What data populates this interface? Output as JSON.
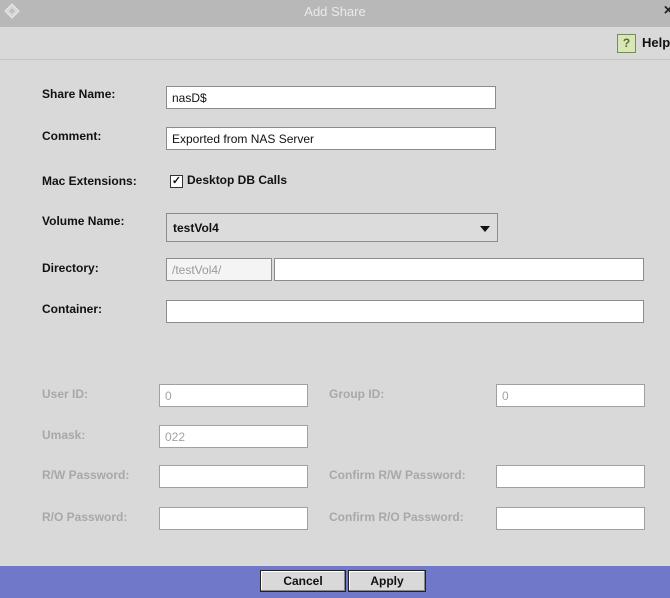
{
  "window": {
    "title": "Add Share",
    "close_label": "×",
    "help_label": "Help",
    "help_icon_glyph": "?"
  },
  "form": {
    "share_name": {
      "label": "Share Name:",
      "value": "nasD$"
    },
    "comment": {
      "label": "Comment:",
      "value": "Exported from NAS Server"
    },
    "mac_extensions": {
      "label": "Mac Extensions:",
      "checkbox_label": "Desktop DB Calls",
      "checked": true,
      "check_glyph": "✓"
    },
    "volume_name": {
      "label": "Volume Name:",
      "value": "testVol4"
    },
    "directory": {
      "label": "Directory:",
      "prefix": "/testVol4/",
      "value": ""
    },
    "container": {
      "label": "Container:",
      "value": ""
    },
    "user_id": {
      "label": "User ID:",
      "value": "0"
    },
    "group_id": {
      "label": "Group ID:",
      "value": "0"
    },
    "umask": {
      "label": "Umask:",
      "value": "022"
    },
    "rw_password": {
      "label": "R/W Password:",
      "value": ""
    },
    "confirm_rw_password": {
      "label": "Confirm R/W Password:",
      "value": ""
    },
    "ro_password": {
      "label": "R/O Password:",
      "value": ""
    },
    "confirm_ro_password": {
      "label": "Confirm R/O Password:",
      "value": ""
    }
  },
  "buttons": {
    "cancel": "Cancel",
    "apply": "Apply"
  },
  "colors": {
    "background": "#d9d9d9",
    "titlebar": "#b8b8b8",
    "bottombar": "#6f78c9",
    "disabled_text": "#a8a8a8"
  }
}
